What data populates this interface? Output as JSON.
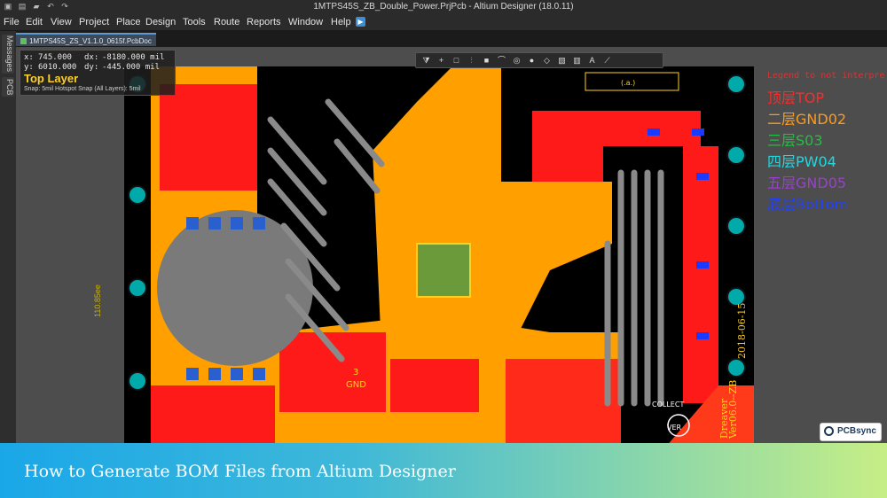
{
  "window": {
    "title": "1MTPS45S_ZB_Double_Power.PrjPcb - Altium Designer (18.0.11)",
    "quick_icons": [
      "save-icon",
      "open-icon",
      "folder-icon",
      "undo-icon",
      "redo-icon"
    ]
  },
  "menu": {
    "items": [
      "File",
      "Edit",
      "View",
      "Project",
      "Place",
      "Design",
      "Tools",
      "Route",
      "Reports",
      "Window",
      "Help"
    ]
  },
  "side_panel": {
    "tabs": [
      "Messages",
      "PCB"
    ]
  },
  "document": {
    "tab_label": "1MTPS45S_ZS_V1.1.0_0615f.PcbDoc"
  },
  "hud": {
    "x_label": "x:",
    "x_value": "745.000",
    "dx_label": "dx:",
    "dx_value": "-8180.000 mil",
    "y_label": "y:",
    "y_value": "6010.000",
    "dy_label": "dy:",
    "dy_value": "-445.000 mil",
    "layer": "Top Layer",
    "snap": "Snap: 5mil Hotspot Snap (All Layers): 5mil"
  },
  "board": {
    "dimension_label": "110.85ee",
    "silk_version": "Ver06.0--ZB",
    "silk_date": "2018-06-15",
    "silk_name": "Dreaver",
    "gnd_text": "GND",
    "gnd_num": "3",
    "collect_label": "COLLECT",
    "ver_label": "VER",
    "box_label": "(.a.)"
  },
  "legend": {
    "header": "Legend to not interpre",
    "layers": [
      {
        "label": "顶层TOP",
        "color": "#ff2a2a"
      },
      {
        "label": "二层GND02",
        "color": "#ff9a1a"
      },
      {
        "label": "三层S03",
        "color": "#20c040"
      },
      {
        "label": "四层PW04",
        "color": "#20d8e0"
      },
      {
        "label": "五层GND05",
        "color": "#9a40d0"
      },
      {
        "label": "底层Bottom",
        "color": "#2040ff"
      }
    ]
  },
  "colors": {
    "top_layer": "#ff1a1a",
    "gnd_layer": "#ffa000",
    "board_bg": "#000000",
    "canvas_bg": "#4d4d4d"
  },
  "caption": "How to Generate BOM Files from Altium Designer",
  "logo": {
    "text": "PCBsync"
  }
}
